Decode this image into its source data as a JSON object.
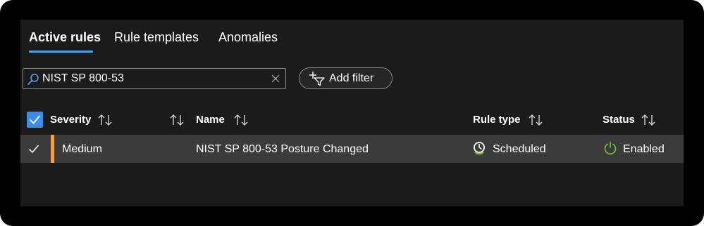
{
  "tabs": [
    {
      "label": "Active rules",
      "active": true
    },
    {
      "label": "Rule templates",
      "active": false
    },
    {
      "label": "Anomalies",
      "active": false
    }
  ],
  "search": {
    "value": "NIST SP 800-53"
  },
  "filter": {
    "add_label": "Add filter"
  },
  "table": {
    "columns": {
      "severity": "Severity",
      "name": "Name",
      "rule_type": "Rule type",
      "status": "Status"
    },
    "rows": [
      {
        "selected": true,
        "severity": "Medium",
        "name": "NIST SP 800-53 Posture Changed",
        "rule_type": "Scheduled",
        "status": "Enabled"
      }
    ]
  },
  "colors": {
    "accent": "#3a8ee6",
    "tab_underline": "#4ea1e6",
    "severity_medium": "#f0a048",
    "status_enabled": "#6fbf3f",
    "panel_bg": "#1b1b1b",
    "row_selected_bg": "#3b3b3b"
  },
  "icons": {
    "search": "search-icon",
    "clear": "close-icon",
    "filter": "add-filter-icon",
    "sort": "sort-icon",
    "check": "checkmark-icon",
    "rule_type": "clock-icon",
    "status": "power-icon"
  }
}
